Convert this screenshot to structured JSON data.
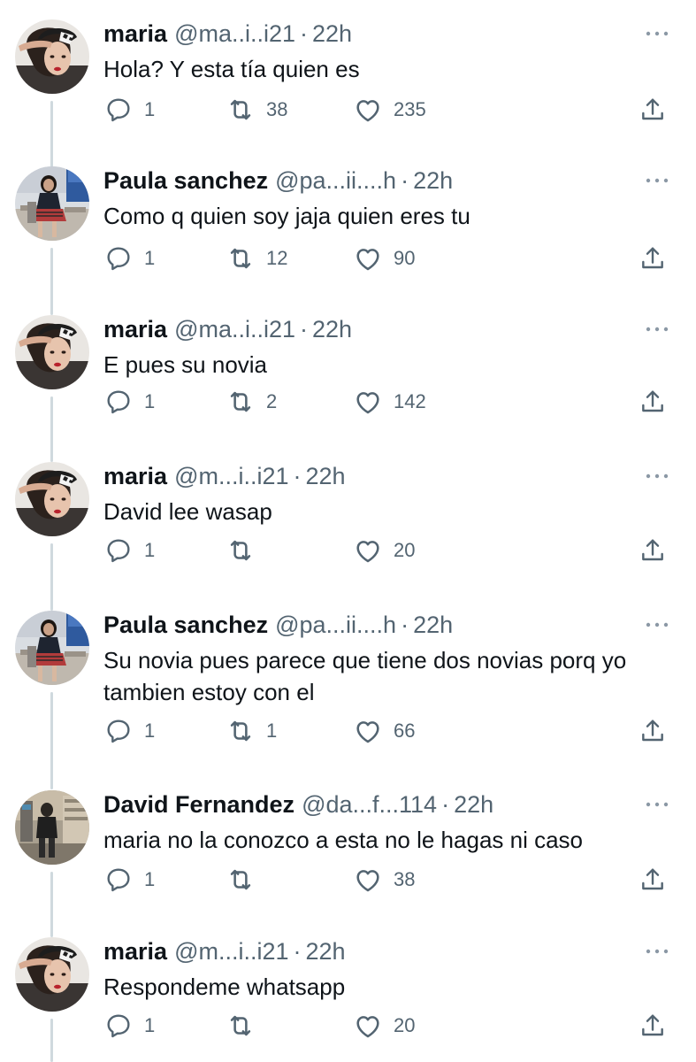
{
  "colors": {
    "text_primary": "#0f1419",
    "text_secondary": "#536471",
    "thread_line": "#cfd9de"
  },
  "icons": {
    "reply": "speech-bubble-icon",
    "retweet": "retweet-arrows-icon",
    "like": "heart-icon",
    "share": "share-upload-icon",
    "more": "more-dots-icon"
  },
  "tweets": [
    {
      "name": "maria",
      "handle": "@ma..i..i21",
      "separator": "·",
      "time": "22h",
      "text": "Hola? Y esta tía quien es",
      "replies": "1",
      "retweets": "38",
      "likes": "235"
    },
    {
      "name": "Paula sanchez",
      "handle": "@pa...ii....h",
      "separator": "·",
      "time": "22h",
      "text": "Como q quien soy jaja quien eres tu",
      "replies": "1",
      "retweets": "12",
      "likes": "90"
    },
    {
      "name": "maria",
      "handle": "@ma..i..i21",
      "separator": "·",
      "time": "22h",
      "text": "E pues su novia",
      "replies": "1",
      "retweets": "2",
      "likes": "142"
    },
    {
      "name": "maria",
      "handle": "@m...i..i21",
      "separator": "·",
      "time": "22h",
      "text": "David lee wasap",
      "replies": "1",
      "retweets": "",
      "likes": "20"
    },
    {
      "name": "Paula sanchez",
      "handle": "@pa...ii....h",
      "separator": "·",
      "time": "22h",
      "text": "Su novia pues parece que tiene dos novias porq yo tambien estoy con el",
      "replies": "1",
      "retweets": "1",
      "likes": "66"
    },
    {
      "name": "David Fernandez",
      "handle": "@da...f...114",
      "separator": "·",
      "time": "22h",
      "text": "maria no la conozco a esta no le hagas ni caso",
      "replies": "1",
      "retweets": "",
      "likes": "38"
    },
    {
      "name": "maria",
      "handle": "@m...i..i21",
      "separator": "·",
      "time": "22h",
      "text": "Respondeme whatsapp",
      "replies": "1",
      "retweets": "",
      "likes": "20"
    }
  ]
}
